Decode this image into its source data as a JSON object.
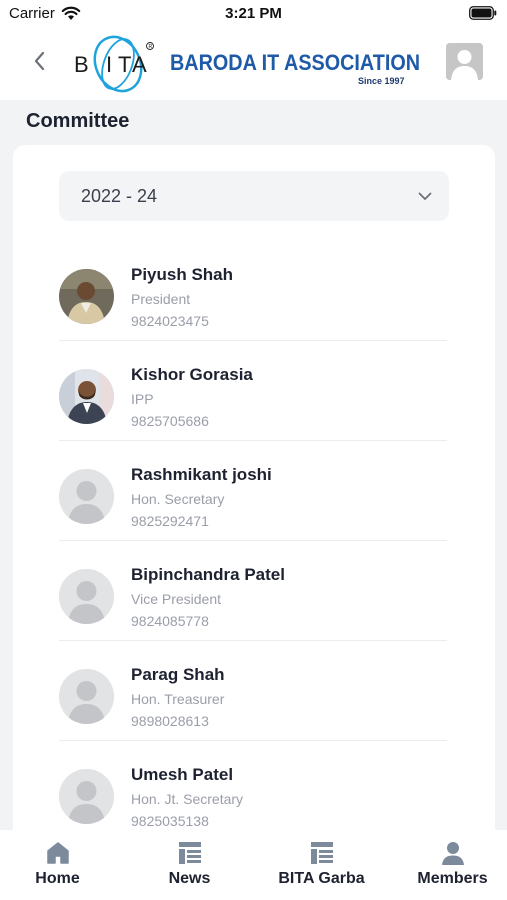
{
  "status_bar": {
    "carrier": "Carrier",
    "time": "3:21 PM"
  },
  "header": {
    "logo_mark": "BITA",
    "org_name": "BARODA IT ASSOCIATION",
    "since": "Since 1997",
    "back_icon": "chevron-left-icon",
    "profile_icon": "user-avatar-icon"
  },
  "page": {
    "title": "Committee"
  },
  "year_select": {
    "value": "2022 - 24"
  },
  "members": [
    {
      "name": "Piyush Shah",
      "role": "President",
      "phone": "9824023475",
      "photo": "photo"
    },
    {
      "name": "Kishor Gorasia",
      "role": "IPP",
      "phone": "9825705686",
      "photo": "photo"
    },
    {
      "name": "Rashmikant joshi",
      "role": "Hon. Secretary",
      "phone": "9825292471",
      "photo": "placeholder"
    },
    {
      "name": "Bipinchandra Patel",
      "role": "Vice President",
      "phone": "9824085778",
      "photo": "placeholder"
    },
    {
      "name": "Parag Shah",
      "role": "Hon. Treasurer",
      "phone": "9898028613",
      "photo": "placeholder"
    },
    {
      "name": "Umesh Patel",
      "role": "Hon. Jt. Secretary",
      "phone": "9825035138",
      "photo": "placeholder"
    }
  ],
  "tabs": [
    {
      "label": "Home",
      "icon": "home-icon"
    },
    {
      "label": "News",
      "icon": "news-icon"
    },
    {
      "label": "BITA Garba",
      "icon": "news-icon"
    },
    {
      "label": "Members",
      "icon": "person-icon"
    }
  ],
  "colors": {
    "brand_blue": "#1f5aa8",
    "tab_icon": "#7d8a9c",
    "secondary_text": "#9a9ea8"
  }
}
